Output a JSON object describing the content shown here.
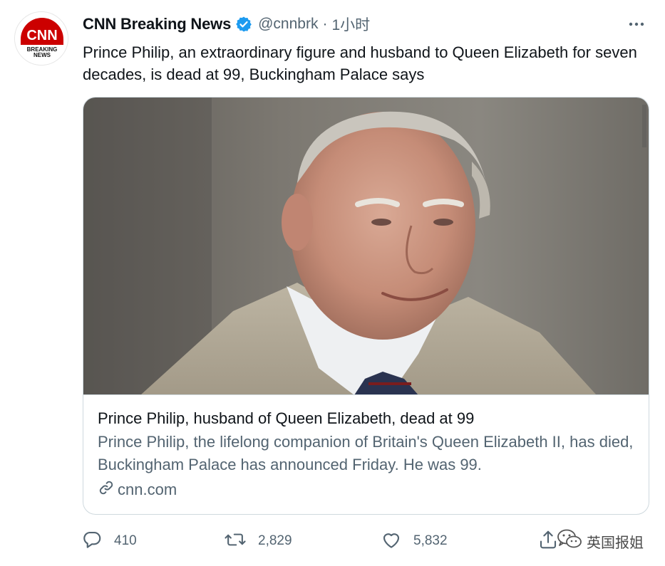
{
  "tweet": {
    "author": {
      "display_name": "CNN Breaking News",
      "handle": "@cnnbrk",
      "verified": true,
      "avatar_text": "CNN",
      "avatar_subtext_line1": "BREAKING",
      "avatar_subtext_line2": "NEWS"
    },
    "separator": "·",
    "time": "1小时",
    "text": "Prince Philip, an extraordinary figure and husband to Queen Elizabeth for seven decades, is dead at 99, Buckingham Palace says"
  },
  "card": {
    "title": "Prince Philip, husband of Queen Elizabeth, dead at 99",
    "description": "Prince Philip, the lifelong companion of Britain's Queen Elizabeth II, has died, Buckingham Palace has announced Friday. He was 99.",
    "domain": "cnn.com"
  },
  "actions": {
    "reply_count": "410",
    "retweet_count": "2,829",
    "like_count": "5,832"
  },
  "watermark": {
    "text": "英国报姐"
  },
  "colors": {
    "primary_text": "#0f1419",
    "secondary_text": "#536471",
    "verified_blue": "#1d9bf0",
    "cnn_red": "#cc0000",
    "border": "#cfd9de"
  },
  "icons": {
    "more": "more-horizontal-icon",
    "verified": "verified-badge-icon",
    "link": "link-icon",
    "reply": "reply-icon",
    "retweet": "retweet-icon",
    "like": "heart-icon",
    "share": "share-icon"
  }
}
